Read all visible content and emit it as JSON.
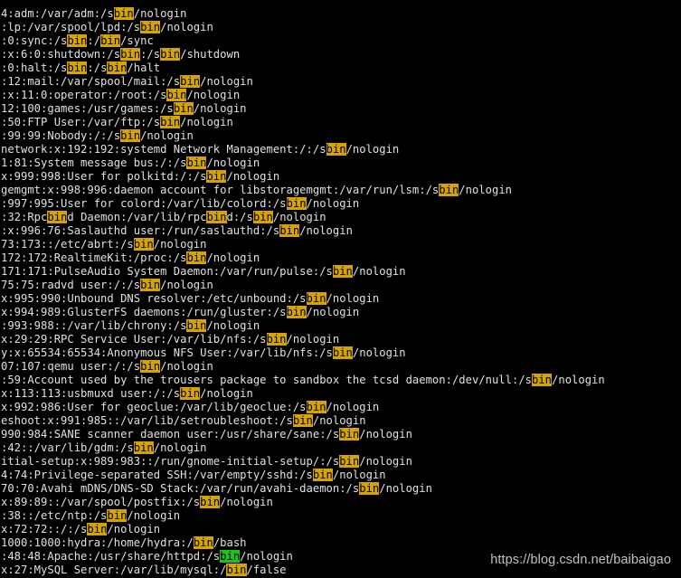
{
  "colors": {
    "background": "#000000",
    "text": "#e0e0e0",
    "search_highlight": "#d6a400",
    "cursor_highlight": "#1ec21e"
  },
  "lines": [
    [
      {
        "t": "4:adm:/var/adm:/s"
      },
      {
        "t": "bin",
        "h": "y"
      },
      {
        "t": "/nologin"
      }
    ],
    [
      {
        "t": ":lp:/var/spool/lpd:/s"
      },
      {
        "t": "bin",
        "h": "y"
      },
      {
        "t": "/nologin"
      }
    ],
    [
      {
        "t": ":0:sync:/s"
      },
      {
        "t": "bin",
        "h": "y"
      },
      {
        "t": ":/"
      },
      {
        "t": "bin",
        "h": "y"
      },
      {
        "t": "/sync"
      }
    ],
    [
      {
        "t": ":x:6:0:shutdown:/s"
      },
      {
        "t": "bin",
        "h": "y"
      },
      {
        "t": ":/s"
      },
      {
        "t": "bin",
        "h": "y"
      },
      {
        "t": "/shutdown"
      }
    ],
    [
      {
        "t": ":0:halt:/s"
      },
      {
        "t": "bin",
        "h": "y"
      },
      {
        "t": ":/s"
      },
      {
        "t": "bin",
        "h": "y"
      },
      {
        "t": "/halt"
      }
    ],
    [
      {
        "t": ":12:mail:/var/spool/mail:/s"
      },
      {
        "t": "bin",
        "h": "y"
      },
      {
        "t": "/nologin"
      }
    ],
    [
      {
        "t": ":x:11:0:operator:/root:/s"
      },
      {
        "t": "bin",
        "h": "y"
      },
      {
        "t": "/nologin"
      }
    ],
    [
      {
        "t": "12:100:games:/usr/games:/s"
      },
      {
        "t": "bin",
        "h": "y"
      },
      {
        "t": "/nologin"
      }
    ],
    [
      {
        "t": ":50:FTP User:/var/ftp:/s"
      },
      {
        "t": "bin",
        "h": "y"
      },
      {
        "t": "/nologin"
      }
    ],
    [
      {
        "t": ":99:99:Nobody:/:/s"
      },
      {
        "t": "bin",
        "h": "y"
      },
      {
        "t": "/nologin"
      }
    ],
    [
      {
        "t": "network:x:192:192:systemd Network Management:/:/s"
      },
      {
        "t": "bin",
        "h": "y"
      },
      {
        "t": "/nologin"
      }
    ],
    [
      {
        "t": "1:81:System message bus:/:/s"
      },
      {
        "t": "bin",
        "h": "y"
      },
      {
        "t": "/nologin"
      }
    ],
    [
      {
        "t": "x:999:998:User for polkitd:/:/s"
      },
      {
        "t": "bin",
        "h": "y"
      },
      {
        "t": "/nologin"
      }
    ],
    [
      {
        "t": "gemgmt:x:998:996:daemon account for libstoragemgmt:/var/run/lsm:/s"
      },
      {
        "t": "bin",
        "h": "y"
      },
      {
        "t": "/nologin"
      }
    ],
    [
      {
        "t": ":997:995:User for colord:/var/lib/colord:/s"
      },
      {
        "t": "bin",
        "h": "y"
      },
      {
        "t": "/nologin"
      }
    ],
    [
      {
        "t": ":32:Rpc"
      },
      {
        "t": "bin",
        "h": "y"
      },
      {
        "t": "d Daemon:/var/lib/rpc"
      },
      {
        "t": "bin",
        "h": "y"
      },
      {
        "t": "d:/s"
      },
      {
        "t": "bin",
        "h": "y"
      },
      {
        "t": "/nologin"
      }
    ],
    [
      {
        "t": ":x:996:76:Saslauthd user:/run/saslauthd:/s"
      },
      {
        "t": "bin",
        "h": "y"
      },
      {
        "t": "/nologin"
      }
    ],
    [
      {
        "t": "73:173::/etc/abrt:/s"
      },
      {
        "t": "bin",
        "h": "y"
      },
      {
        "t": "/nologin"
      }
    ],
    [
      {
        "t": "172:172:RealtimeKit:/proc:/s"
      },
      {
        "t": "bin",
        "h": "y"
      },
      {
        "t": "/nologin"
      }
    ],
    [
      {
        "t": "171:171:PulseAudio System Daemon:/var/run/pulse:/s"
      },
      {
        "t": "bin",
        "h": "y"
      },
      {
        "t": "/nologin"
      }
    ],
    [
      {
        "t": "75:75:radvd user:/:/s"
      },
      {
        "t": "bin",
        "h": "y"
      },
      {
        "t": "/nologin"
      }
    ],
    [
      {
        "t": "x:995:990:Unbound DNS resolver:/etc/unbound:/s"
      },
      {
        "t": "bin",
        "h": "y"
      },
      {
        "t": "/nologin"
      }
    ],
    [
      {
        "t": "x:994:989:GlusterFS daemons:/run/gluster:/s"
      },
      {
        "t": "bin",
        "h": "y"
      },
      {
        "t": "/nologin"
      }
    ],
    [
      {
        "t": ":993:988::/var/lib/chrony:/s"
      },
      {
        "t": "bin",
        "h": "y"
      },
      {
        "t": "/nologin"
      }
    ],
    [
      {
        "t": "x:29:29:RPC Service User:/var/lib/nfs:/s"
      },
      {
        "t": "bin",
        "h": "y"
      },
      {
        "t": "/nologin"
      }
    ],
    [
      {
        "t": "y:x:65534:65534:Anonymous NFS User:/var/lib/nfs:/s"
      },
      {
        "t": "bin",
        "h": "y"
      },
      {
        "t": "/nologin"
      }
    ],
    [
      {
        "t": "07:107:qemu user:/:/s"
      },
      {
        "t": "bin",
        "h": "y"
      },
      {
        "t": "/nologin"
      }
    ],
    [
      {
        "t": ":59:Account used by the trousers package to sandbox the tcsd daemon:/dev/null:/s"
      },
      {
        "t": "bin",
        "h": "y"
      },
      {
        "t": "/nologin"
      }
    ],
    [
      {
        "t": "x:113:113:usbmuxd user:/:/s"
      },
      {
        "t": "bin",
        "h": "y"
      },
      {
        "t": "/nologin"
      }
    ],
    [
      {
        "t": "x:992:986:User for geoclue:/var/lib/geoclue:/s"
      },
      {
        "t": "bin",
        "h": "y"
      },
      {
        "t": "/nologin"
      }
    ],
    [
      {
        "t": "eshoot:x:991:985::/var/lib/setroubleshoot:/s"
      },
      {
        "t": "bin",
        "h": "y"
      },
      {
        "t": "/nologin"
      }
    ],
    [
      {
        "t": "990:984:SANE scanner daemon user:/usr/share/sane:/s"
      },
      {
        "t": "bin",
        "h": "y"
      },
      {
        "t": "/nologin"
      }
    ],
    [
      {
        "t": ":42::/var/lib/gdm:/s"
      },
      {
        "t": "bin",
        "h": "y"
      },
      {
        "t": "/nologin"
      }
    ],
    [
      {
        "t": "itial-setup:x:989:983::/run/gnome-initial-setup/:/s"
      },
      {
        "t": "bin",
        "h": "y"
      },
      {
        "t": "/nologin"
      }
    ],
    [
      {
        "t": "4:74:Privilege-separated SSH:/var/empty/sshd:/s"
      },
      {
        "t": "bin",
        "h": "y"
      },
      {
        "t": "/nologin"
      }
    ],
    [
      {
        "t": "70:70:Avahi mDNS/DNS-SD Stack:/var/run/avahi-daemon:/s"
      },
      {
        "t": "bin",
        "h": "y"
      },
      {
        "t": "/nologin"
      }
    ],
    [
      {
        "t": "x:89:89::/var/spool/postfix:/s"
      },
      {
        "t": "bin",
        "h": "y"
      },
      {
        "t": "/nologin"
      }
    ],
    [
      {
        "t": ":38::/etc/ntp:/s"
      },
      {
        "t": "bin",
        "h": "y"
      },
      {
        "t": "/nologin"
      }
    ],
    [
      {
        "t": "x:72:72::/:/s"
      },
      {
        "t": "bin",
        "h": "y"
      },
      {
        "t": "/nologin"
      }
    ],
    [
      {
        "t": "1000:1000:hydra:/home/hydra:/"
      },
      {
        "t": "bin",
        "h": "y"
      },
      {
        "t": "/bash"
      }
    ],
    [
      {
        "t": ":48:48:Apache:/usr/share/httpd:/s"
      },
      {
        "t": "bin",
        "h": "g"
      },
      {
        "t": "/nologin"
      }
    ],
    [
      {
        "t": "x:27:MySQL Server:/var/lib/mysql:/"
      },
      {
        "t": "bin",
        "h": "y"
      },
      {
        "t": "/false"
      }
    ]
  ],
  "watermark": "https://blog.csdn.net/baibaigao"
}
